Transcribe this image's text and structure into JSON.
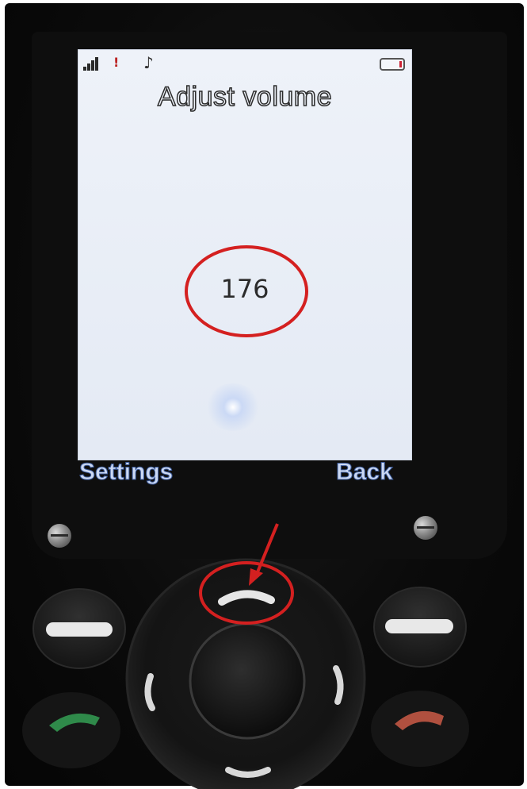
{
  "screen": {
    "title": "Adjust volume",
    "volume_value": "176",
    "left_softkey": "Settings",
    "right_softkey": "Back"
  },
  "status_bar": {
    "signal_icon": "signal-strength-icon",
    "alert_icon": "exclamation-icon",
    "alert_glyph": "!",
    "music_icon": "music-note-icon",
    "music_glyph": "♪",
    "battery_icon": "battery-icon"
  },
  "keypad": {
    "left_soft_button_icon": "minus-icon",
    "right_soft_button_icon": "minus-icon",
    "nav_up_icon": "arc-up-icon",
    "call_icon": "green-handset-icon",
    "end_icon": "red-handset-icon"
  },
  "annotations": {
    "highlight_color": "#d42020",
    "note": "red circles highlight the volume value and the navigation up key; red arrow points at the up key"
  }
}
